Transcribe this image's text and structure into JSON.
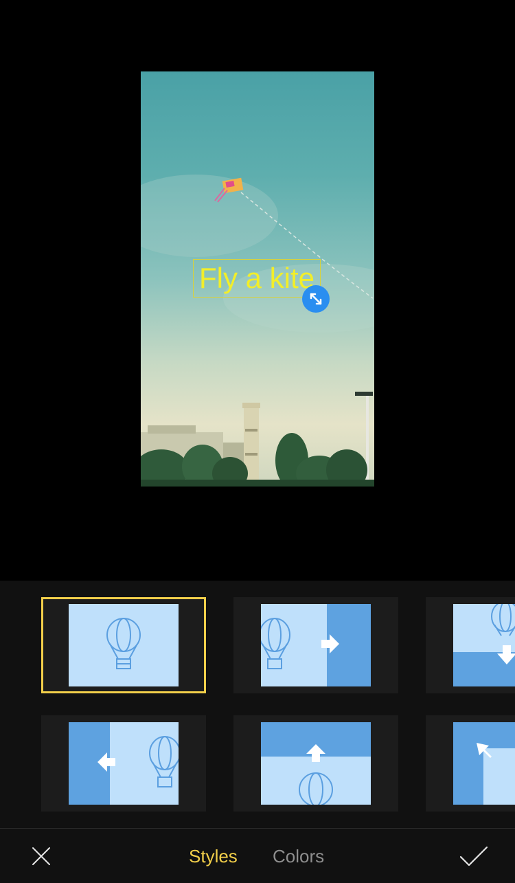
{
  "preview": {
    "overlay_text": "Fly a kite",
    "text_color": "#f2ee2a",
    "handle_icon": "resize-arrows-icon"
  },
  "styles": {
    "tiles": [
      {
        "id": "static",
        "icon": "hot-air-balloon-icon",
        "selected": true
      },
      {
        "id": "slide-right",
        "icon": "arrow-right-icon",
        "selected": false
      },
      {
        "id": "slide-down",
        "icon": "arrow-down-icon",
        "selected": false
      },
      {
        "id": "slide-left",
        "icon": "arrow-left-icon",
        "selected": false
      },
      {
        "id": "slide-up",
        "icon": "arrow-up-icon",
        "selected": false
      },
      {
        "id": "slide-up-left",
        "icon": "arrow-up-left-icon",
        "selected": false
      }
    ],
    "accent_color": "#f2cf4a"
  },
  "toolbar": {
    "close_icon": "close-icon",
    "tabs": [
      {
        "label": "Styles",
        "active": true
      },
      {
        "label": "Colors",
        "active": false
      }
    ],
    "done_icon": "checkmark-icon"
  }
}
